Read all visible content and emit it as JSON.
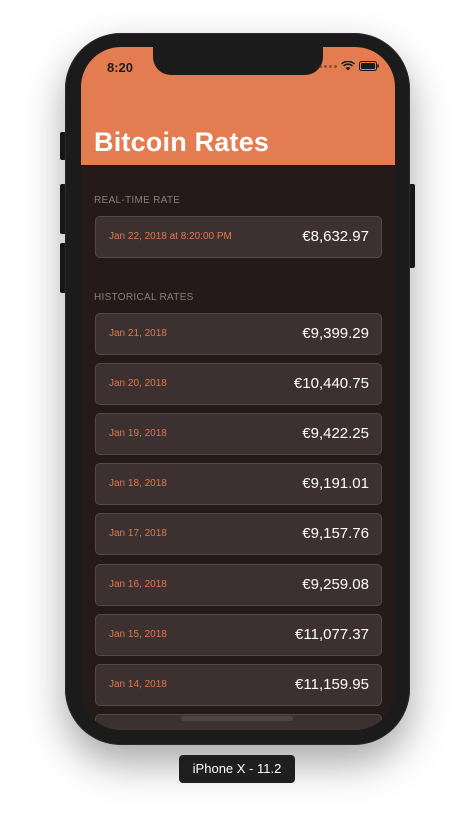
{
  "status_bar": {
    "time": "8:20",
    "icons": [
      "signal-icon",
      "wifi-icon",
      "battery-icon"
    ]
  },
  "header": {
    "title": "Bitcoin Rates",
    "color": "#e37c50"
  },
  "realtime": {
    "section_label": "REAL-TIME RATE",
    "date": "Jan 22, 2018 at 8:20:00 PM",
    "value": "€8,632.97"
  },
  "historical": {
    "section_label": "HISTORICAL RATES",
    "rows": [
      {
        "date": "Jan 21, 2018",
        "value": "€9,399.29"
      },
      {
        "date": "Jan 20, 2018",
        "value": "€10,440.75"
      },
      {
        "date": "Jan 19, 2018",
        "value": "€9,422.25"
      },
      {
        "date": "Jan 18, 2018",
        "value": "€9,191.01"
      },
      {
        "date": "Jan 17, 2018",
        "value": "€9,157.76"
      },
      {
        "date": "Jan 16, 2018",
        "value": "€9,259.08"
      },
      {
        "date": "Jan 15, 2018",
        "value": "€11,077.37"
      },
      {
        "date": "Jan 14, 2018",
        "value": "€11,159.95"
      }
    ]
  },
  "device_label": "iPhone X - 11.2",
  "colors": {
    "accent": "#e37c50",
    "background": "#241a19",
    "row_background": "#3c3130",
    "date_text": "#e1774e"
  }
}
